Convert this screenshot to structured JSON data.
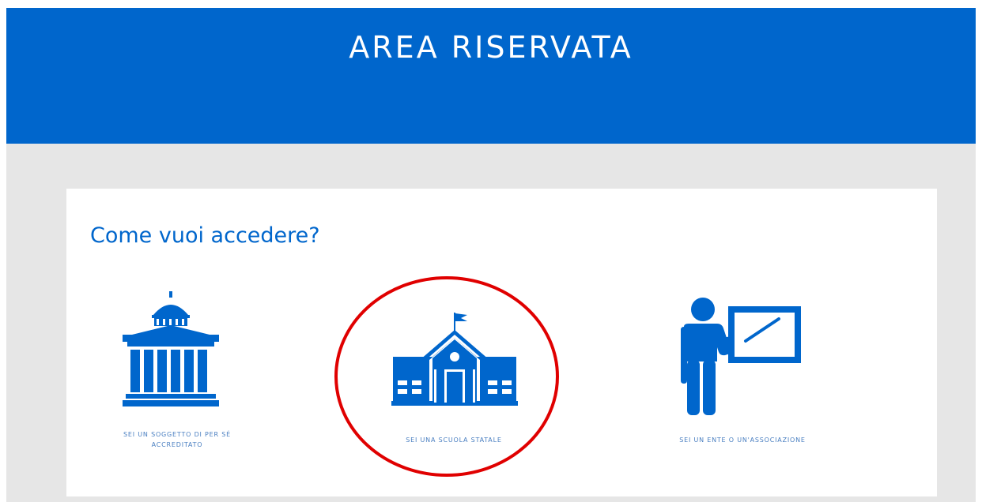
{
  "header": {
    "title": "AREA RISERVATA"
  },
  "card": {
    "title": "Come vuoi accedere?",
    "options": [
      {
        "label": "SEI UN SOGGETTO DI PER SÉ ACCREDITATO",
        "icon": "university-building-icon"
      },
      {
        "label": "SEI UNA SCUOLA STATALE",
        "icon": "school-building-icon"
      },
      {
        "label": "SEI UN ENTE O UN'ASSOCIAZIONE",
        "icon": "teacher-board-icon"
      }
    ]
  },
  "colors": {
    "brand_blue": "#0066cc",
    "background": "#e6e6e6",
    "highlight_ring": "#e00000"
  }
}
